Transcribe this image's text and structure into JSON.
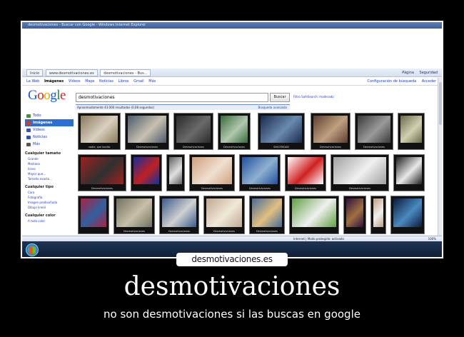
{
  "browser": {
    "window_title": "desmotivaciones - Buscar con Google - Windows Internet Explorer",
    "tabs": [
      "Inicio",
      "www.desmotivaciones.es",
      "desmotivaciones - Bus..."
    ],
    "toolbar_right": [
      "Página",
      "Seguridad"
    ],
    "status_zone": "Internet | Modo protegido: activado",
    "zoom": "100%"
  },
  "google": {
    "top_links": [
      "La Web",
      "Imágenes",
      "Vídeos",
      "Maps",
      "Noticias",
      "Libros",
      "Gmail",
      "Más"
    ],
    "top_right": [
      "Configuración de búsqueda",
      "Acceder"
    ],
    "logo_letters": [
      "G",
      "o",
      "o",
      "g",
      "l",
      "e"
    ],
    "search_value": "desmotivaciones",
    "search_button": "Buscar",
    "safesearch": "Filtro SafeSearch: moderado",
    "stats": "Aproximadamente 43.000 resultados (0,08 segundos)",
    "advanced": "Búsqueda avanzada"
  },
  "sidebar": {
    "items": [
      {
        "label": "Todo",
        "icon": "all-icon",
        "color": "#4a8f3c"
      },
      {
        "label": "Imágenes",
        "icon": "images-icon",
        "color": "#d04020"
      },
      {
        "label": "Vídeos",
        "icon": "videos-icon",
        "color": "#3050c0"
      },
      {
        "label": "Noticias",
        "icon": "news-icon",
        "color": "#3050c0"
      },
      {
        "label": "Más",
        "icon": "more-icon",
        "color": "#555555"
      }
    ],
    "size_head": "Cualquier tamaño",
    "size_opts": [
      "Grande",
      "Mediano",
      "Icono",
      "Mayor que...",
      "Tamaño exacto..."
    ],
    "type_head": "Cualquier tipo",
    "type_opts": [
      "Cara",
      "Fotografía",
      "Imagen prediseñada",
      "Dibujo lineal"
    ],
    "color_head": "Cualquier color",
    "color_opts": [
      "A todo color"
    ]
  },
  "results": [
    {
      "cap": "nadie, que bonito",
      "c1": "#8a7a5a",
      "c2": "#d8d0c0"
    },
    {
      "cap": "Desmotivaciones",
      "c1": "#4a5a6a",
      "c2": "#c8c0b0"
    },
    {
      "cap": "Desmotivaciones",
      "c1": "#2a2a2a",
      "c2": "#6a6a6a"
    },
    {
      "cap": "Desmotivaciones",
      "c1": "#3a6a3a",
      "c2": "#b0c8b0"
    },
    {
      "cap": "SINCERIDAD",
      "c1": "#1a2a4a",
      "c2": "#6a8ab0"
    },
    {
      "cap": "Desmotivaciones",
      "c1": "#5a4030",
      "c2": "#c0a080"
    },
    {
      "cap": "Desmotivaciones",
      "c1": "#3a3a3a",
      "c2": "#9a9a9a"
    },
    {
      "cap": "",
      "c1": "#6a6a4a",
      "c2": "#d0d0b0"
    },
    {
      "cap": "Desmotivaciones",
      "c1": "#a02020",
      "c2": "#303030"
    },
    {
      "cap": "",
      "c1": "#1030a0",
      "c2": "#c02020"
    },
    {
      "cap": "",
      "c1": "#606060",
      "c2": "#e0e0e0"
    },
    {
      "cap": "Desmotivaciones",
      "c1": "#d0a080",
      "c2": "#f0e0d0"
    },
    {
      "cap": "Desmotivaciones",
      "c1": "#2050a0",
      "c2": "#90b0d0"
    },
    {
      "cap": "Desmotivaciones",
      "c1": "#ffffff",
      "c2": "#d02020"
    },
    {
      "cap": "Desmotivaciones",
      "c1": "#a0a0a0",
      "c2": "#f0f0f0"
    },
    {
      "cap": "",
      "c1": "#202020",
      "c2": "#e8e8e8"
    },
    {
      "cap": "",
      "c1": "#b02040",
      "c2": "#3060a0"
    },
    {
      "cap": "Desmotivaciones",
      "c1": "#707060",
      "c2": "#c8c0a8"
    },
    {
      "cap": "Desmotivaciones",
      "c1": "#3a5a8a",
      "c2": "#d0d0d0"
    },
    {
      "cap": "Desmotivaciones",
      "c1": "#c0a890",
      "c2": "#f0e8d8"
    },
    {
      "cap": "Desmotivaciones",
      "c1": "#4a6a9a",
      "c2": "#e0c080"
    },
    {
      "cap": "",
      "c1": "#60a040",
      "c2": "#f0f0f0"
    },
    {
      "cap": "",
      "c1": "#301040",
      "c2": "#a07040"
    },
    {
      "cap": "",
      "c1": "#c0a080",
      "c2": "#f0f0f0"
    },
    {
      "cap": "",
      "c1": "#0a1a3a",
      "c2": "#4a8ac0"
    }
  ],
  "poster": {
    "site": "desmotivaciones.es",
    "title": "desmotivaciones",
    "subtitle": "no son desmotivaciones si las buscas en google"
  }
}
